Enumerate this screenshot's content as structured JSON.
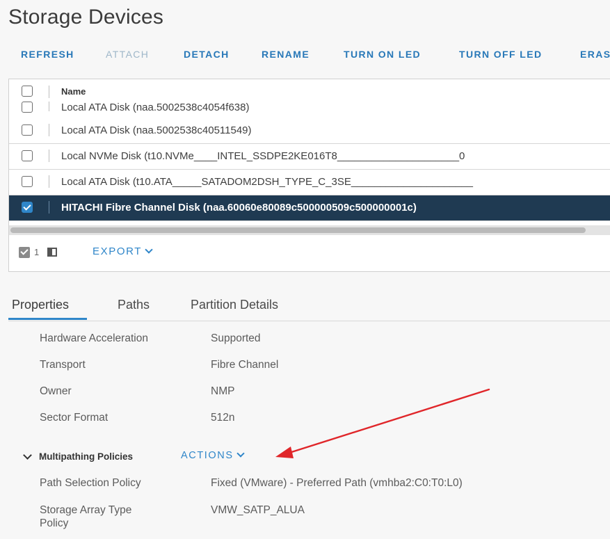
{
  "page": {
    "title": "Storage Devices"
  },
  "toolbar": {
    "refresh": "REFRESH",
    "attach": "ATTACH",
    "detach": "DETACH",
    "rename": "RENAME",
    "turn_on_led": "TURN ON LED",
    "turn_off_led": "TURN OFF LED",
    "erase": "ERAS"
  },
  "grid": {
    "column_name": "Name",
    "rows": [
      {
        "name": "Local ATA Disk (naa.5002538c4054f638)",
        "checked": false
      },
      {
        "name": "Local ATA Disk (naa.5002538c40511549)",
        "checked": false
      },
      {
        "name": "Local NVMe Disk (t10.NVMe____INTEL_SSDPE2KE016T8_____________________0",
        "checked": false
      },
      {
        "name": "Local ATA Disk (t10.ATA_____SATADOM2DSH_TYPE_C_3SE_____________________",
        "checked": false
      },
      {
        "name": "HITACHI Fibre Channel Disk (naa.60060e80089c500000509c500000001c)",
        "checked": true
      }
    ],
    "footer": {
      "selected_count": "1",
      "export": "EXPORT"
    }
  },
  "tabs": [
    {
      "label": "Properties",
      "active": true
    },
    {
      "label": "Paths",
      "active": false
    },
    {
      "label": "Partition Details",
      "active": false
    }
  ],
  "properties": {
    "hardware_acceleration": {
      "label": "Hardware Acceleration",
      "value": "Supported"
    },
    "transport": {
      "label": "Transport",
      "value": "Fibre Channel"
    },
    "owner": {
      "label": "Owner",
      "value": "NMP"
    },
    "sector_format": {
      "label": "Sector Format",
      "value": "512n"
    }
  },
  "multipathing": {
    "title": "Multipathing Policies",
    "actions": "ACTIONS",
    "path_selection_policy": {
      "label": "Path Selection Policy",
      "value": "Fixed (VMware) - Preferred Path (vmhba2:C0:T0:L0)"
    },
    "storage_array_type_policy": {
      "label_line1": "Storage Array Type",
      "label_line2": "Policy",
      "value": "VMW_SATP_ALUA"
    }
  },
  "colors": {
    "accent": "#2f86c9",
    "selected_row": "#1f3a52",
    "annotation_arrow": "#e0262a"
  }
}
